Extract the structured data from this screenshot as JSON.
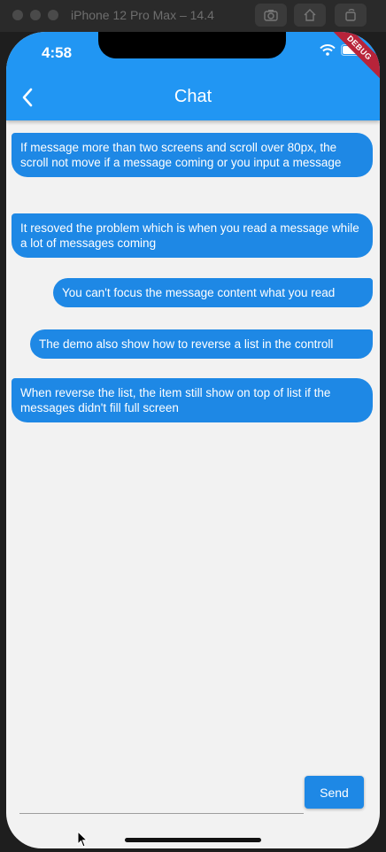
{
  "simulator": {
    "title": "iPhone 12 Pro Max – 14.4"
  },
  "status_bar": {
    "time": "4:58",
    "debug_label": "DEBUG"
  },
  "app_bar": {
    "title": "Chat",
    "back_icon": "chevron-left-icon"
  },
  "messages": [
    {
      "text": "If message more than two screens and scroll over 80px, the scroll not move if a message coming or you input a message",
      "side": "left"
    },
    {
      "text": "It resoved the problem which is when you read a message while a lot of messages coming",
      "side": "left"
    },
    {
      "text": "You can't focus the message content what you read",
      "side": "right"
    },
    {
      "text": "The demo also show how to reverse a list in the controll",
      "side": "right"
    },
    {
      "text": "When reverse the list, the item still show on top of list if the messages didn't fill full screen",
      "side": "left"
    }
  ],
  "composer": {
    "send_label": "Send",
    "input_value": ""
  },
  "colors": {
    "app_bar": "#2196f3",
    "bubble": "#1e88e5",
    "background": "#f2f2f2",
    "debug_ribbon": "#b8243a"
  }
}
